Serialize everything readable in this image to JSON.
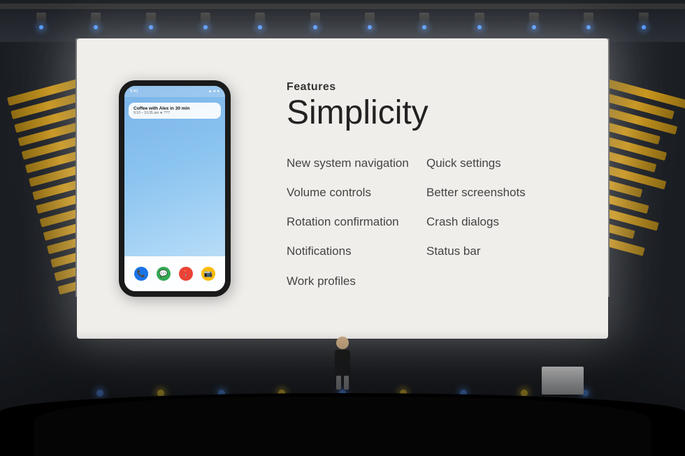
{
  "stage": {
    "background_color": "#1a1a1a"
  },
  "screen": {
    "features_label": "Features",
    "title": "Simplicity",
    "feature_col1": [
      "New system navigation",
      "Volume controls",
      "Rotation confirmation",
      "Notifications",
      "Work profiles"
    ],
    "feature_col2": [
      "Quick settings",
      "Better screenshots",
      "Crash dialogs",
      "Status bar"
    ]
  },
  "phone": {
    "notification_title": "Coffee with Alex in 30 min",
    "notification_time": "9:10 – 10:35 am  ★ ???"
  }
}
